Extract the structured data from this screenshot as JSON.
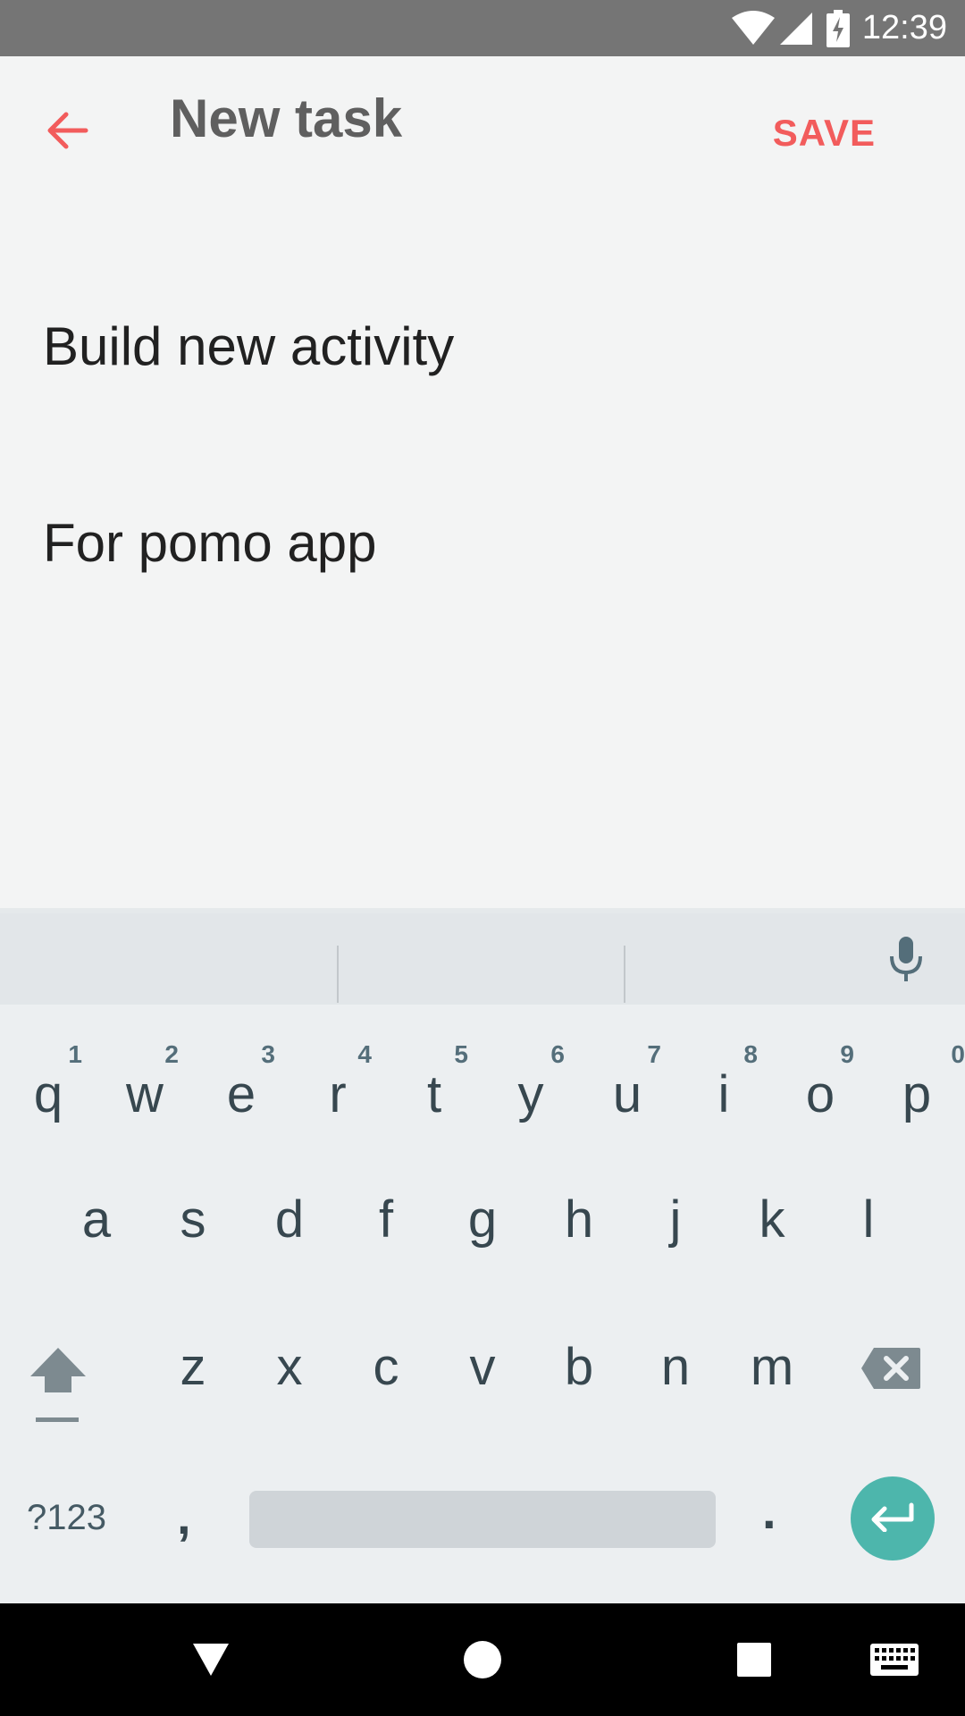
{
  "status_bar": {
    "time": "12:39",
    "icons": [
      "wifi-icon",
      "cell-signal-icon",
      "battery-charging-icon"
    ]
  },
  "app_bar": {
    "title": "New task",
    "save_label": "SAVE",
    "back_icon": "arrow-left-icon",
    "accent_color": "#f25c5c"
  },
  "task": {
    "title_value": "Build new activity",
    "description_value": "For pomo app"
  },
  "keyboard": {
    "row1": [
      {
        "key": "q",
        "hint": "1"
      },
      {
        "key": "w",
        "hint": "2"
      },
      {
        "key": "e",
        "hint": "3"
      },
      {
        "key": "r",
        "hint": "4"
      },
      {
        "key": "t",
        "hint": "5"
      },
      {
        "key": "y",
        "hint": "6"
      },
      {
        "key": "u",
        "hint": "7"
      },
      {
        "key": "i",
        "hint": "8"
      },
      {
        "key": "o",
        "hint": "9"
      },
      {
        "key": "p",
        "hint": "0"
      }
    ],
    "row2": [
      "a",
      "s",
      "d",
      "f",
      "g",
      "h",
      "j",
      "k",
      "l"
    ],
    "row3": [
      "z",
      "x",
      "c",
      "v",
      "b",
      "n",
      "m"
    ],
    "symbols_label": "?123",
    "comma_label": ",",
    "period_label": ".",
    "enter_color": "#4db6ac"
  },
  "nav_bar": {
    "buttons": [
      "back-triangle-icon",
      "home-circle-icon",
      "recents-square-icon",
      "keyboard-icon"
    ]
  }
}
